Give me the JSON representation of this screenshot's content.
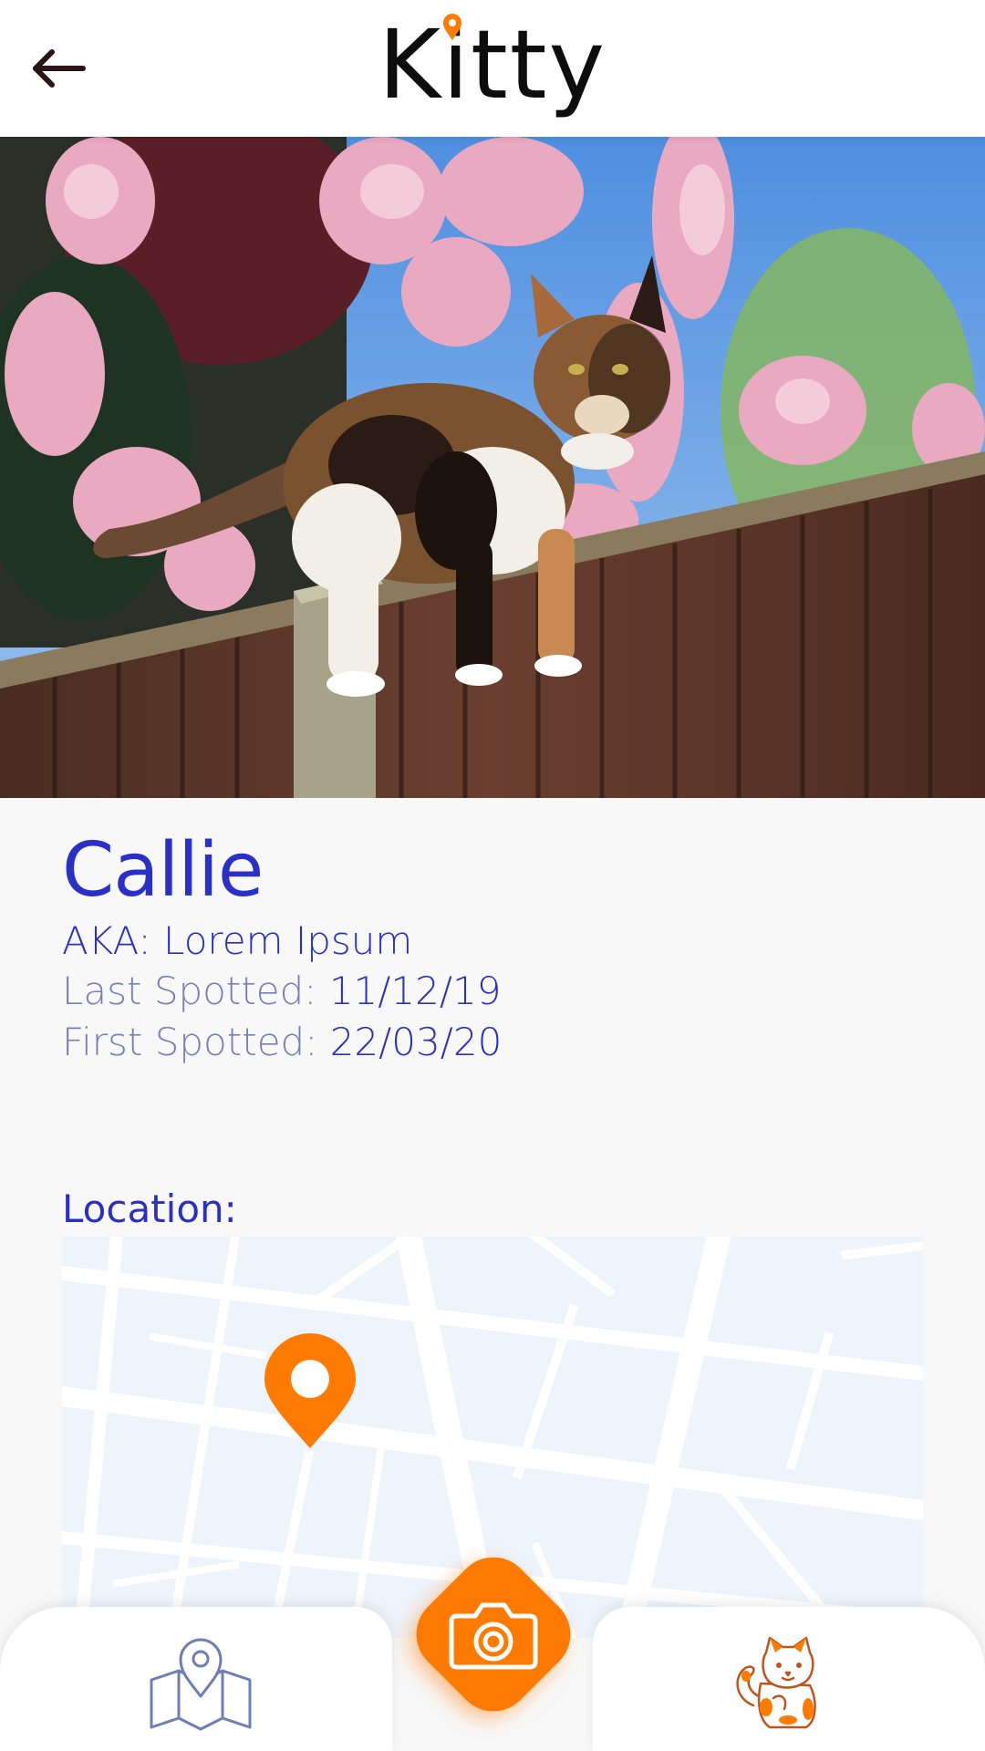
{
  "app": {
    "logo_text": "Kitty",
    "brand_color": "#ff7a00",
    "text_color": "#2b2fc9"
  },
  "header": {
    "back_icon": "back-arrow-icon"
  },
  "cat": {
    "name": "Callie",
    "aka": "AKA: Lorem Ipsum",
    "last_spotted_label": "Last Spotted:",
    "last_spotted_value": "11/12/19",
    "first_spotted_label": "First Spotted:",
    "first_spotted_value": "22/03/20"
  },
  "location": {
    "label": "Location:",
    "pin_icon": "map-pin-icon"
  },
  "nav": {
    "map_icon": "folded-map-icon",
    "camera_icon": "camera-icon",
    "cat_icon": "cat-icon"
  }
}
